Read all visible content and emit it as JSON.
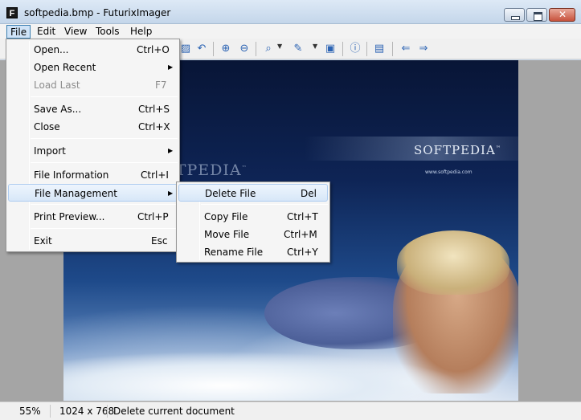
{
  "window": {
    "icon_letter": "F",
    "title": "softpedia.bmp - FuturixImager",
    "minimize_label": "",
    "maximize_label": "",
    "close_label": ""
  },
  "menubar": [
    {
      "label": "File"
    },
    {
      "label": "Edit"
    },
    {
      "label": "View"
    },
    {
      "label": "Tools"
    },
    {
      "label": "Help"
    }
  ],
  "file_menu": [
    {
      "label": "Open...",
      "shortcut": "Ctrl+O"
    },
    {
      "label": "Open Recent",
      "shortcut": ""
    },
    {
      "label": "Load Last",
      "shortcut": "F7"
    },
    {
      "label": "Save As...",
      "shortcut": "Ctrl+S"
    },
    {
      "label": "Close",
      "shortcut": "Ctrl+X"
    },
    {
      "label": "Import",
      "shortcut": ""
    },
    {
      "label": "File Information",
      "shortcut": "Ctrl+I"
    },
    {
      "label": "File Management",
      "shortcut": ""
    },
    {
      "label": "Print Preview...",
      "shortcut": "Ctrl+P"
    },
    {
      "label": "Exit",
      "shortcut": "Esc"
    }
  ],
  "file_management_menu": [
    {
      "label": "Delete File",
      "shortcut": "Del"
    },
    {
      "label": "Copy File",
      "shortcut": "Ctrl+T"
    },
    {
      "label": "Move File",
      "shortcut": "Ctrl+M"
    },
    {
      "label": "Rename File",
      "shortcut": "Ctrl+Y"
    }
  ],
  "toolbar_icons": [
    "rotate-icon",
    "undo-icon",
    "zoom-in-icon",
    "zoom-out-icon",
    "zoom-dropdown-icon",
    "edit-dropdown-icon",
    "fit-window-icon",
    "info-icon",
    "browse-folder-icon",
    "previous-icon",
    "next-icon"
  ],
  "image": {
    "brand": "SOFTPEDIA",
    "brand_mark": "™",
    "url": "www.softpedia.com",
    "watermark": "SOFTPEDIA",
    "watermark_mark": "™"
  },
  "status": {
    "zoom": "55%",
    "dimensions": "1024 x 768",
    "message": "Delete current document"
  },
  "colors": {
    "highlight_border": "#aeccf0",
    "menu_active_bg": "#cfe3f7",
    "canvas_bg": "#a5a5a5"
  }
}
